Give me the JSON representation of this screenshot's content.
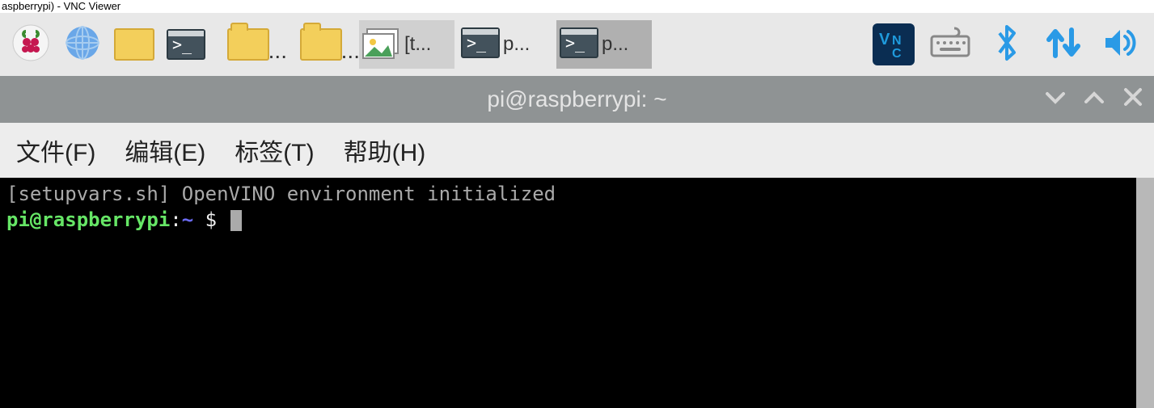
{
  "vnc_window_title": "aspberrypi) - VNC Viewer",
  "taskbar": {
    "app_items": [
      {
        "label_visible": "[t...",
        "icon": "picture-icon"
      },
      {
        "label_visible": "p...",
        "icon": "terminal-icon"
      },
      {
        "label_visible": "p...",
        "icon": "terminal-icon"
      }
    ]
  },
  "window": {
    "title": "pi@raspberrypi: ~"
  },
  "menubar": {
    "file": "文件(F)",
    "edit": "编辑(E)",
    "tabs": "标签(T)",
    "help": "帮助(H)"
  },
  "terminal": {
    "line1": "[setupvars.sh] OpenVINO environment initialized",
    "prompt_userhost": "pi@raspberrypi",
    "prompt_sep": ":",
    "prompt_path": "~",
    "prompt_symbol": " $ "
  }
}
